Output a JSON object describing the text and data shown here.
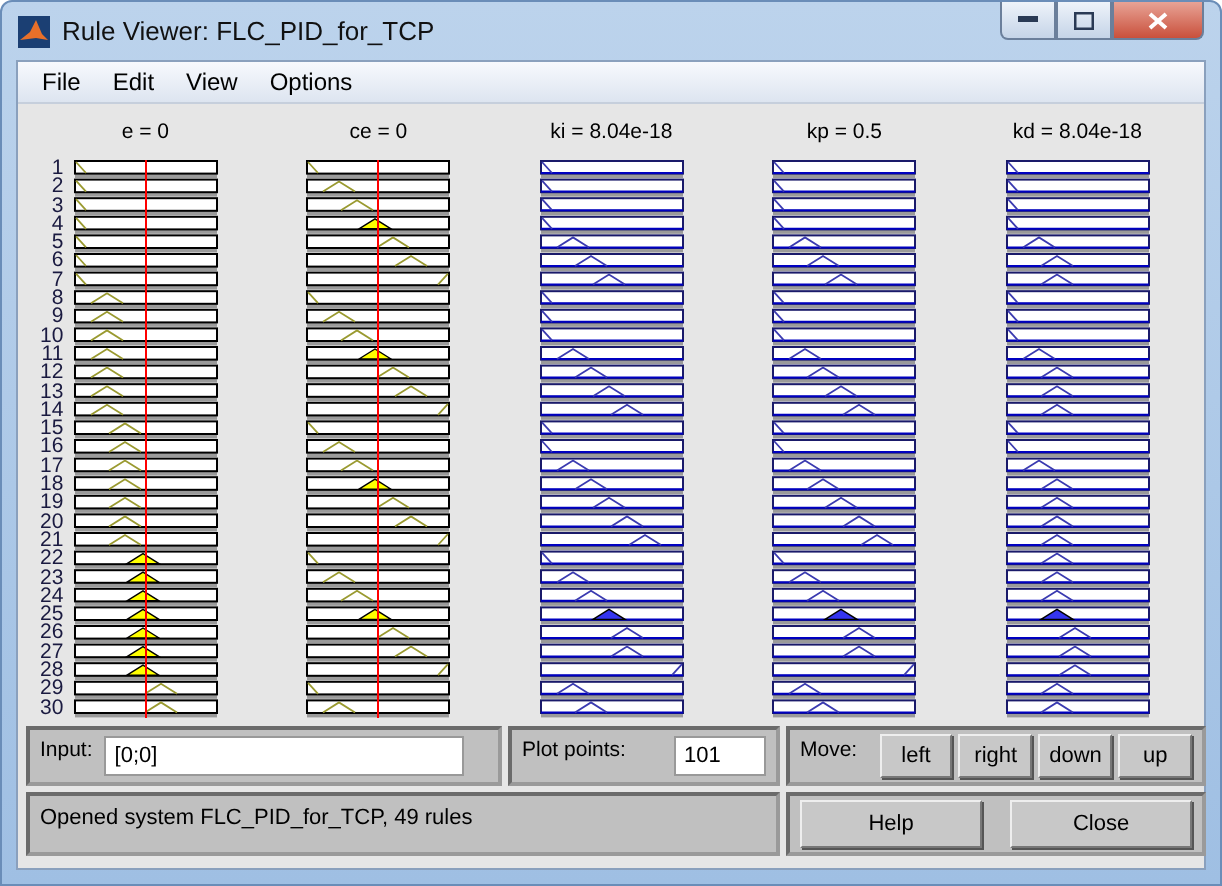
{
  "window": {
    "title": "Rule Viewer: FLC_PID_for_TCP"
  },
  "menu": [
    "File",
    "Edit",
    "View",
    "Options"
  ],
  "variables": [
    {
      "label": "e = 0",
      "kind": "input"
    },
    {
      "label": "ce = 0",
      "kind": "input"
    },
    {
      "label": "ki = 8.04e-18",
      "kind": "output"
    },
    {
      "label": "kp = 0.5",
      "kind": "output"
    },
    {
      "label": "kd = 8.04e-18",
      "kind": "output"
    }
  ],
  "rule_numbers": [
    "1",
    "2",
    "3",
    "4",
    "5",
    "6",
    "7",
    "8",
    "9",
    "10",
    "11",
    "12",
    "13",
    "14",
    "15",
    "16",
    "17",
    "18",
    "19",
    "20",
    "21",
    "22",
    "23",
    "24",
    "25",
    "26",
    "27",
    "28",
    "29",
    "30"
  ],
  "input": {
    "label": "Input:",
    "value": "[0;0]"
  },
  "plot_points": {
    "label": "Plot points:",
    "value": "101"
  },
  "move": {
    "label": "Move:",
    "buttons": [
      "left",
      "right",
      "down",
      "up"
    ]
  },
  "status": "Opened system FLC_PID_for_TCP, 49 rules",
  "buttons": [
    "Help",
    "Close"
  ]
}
